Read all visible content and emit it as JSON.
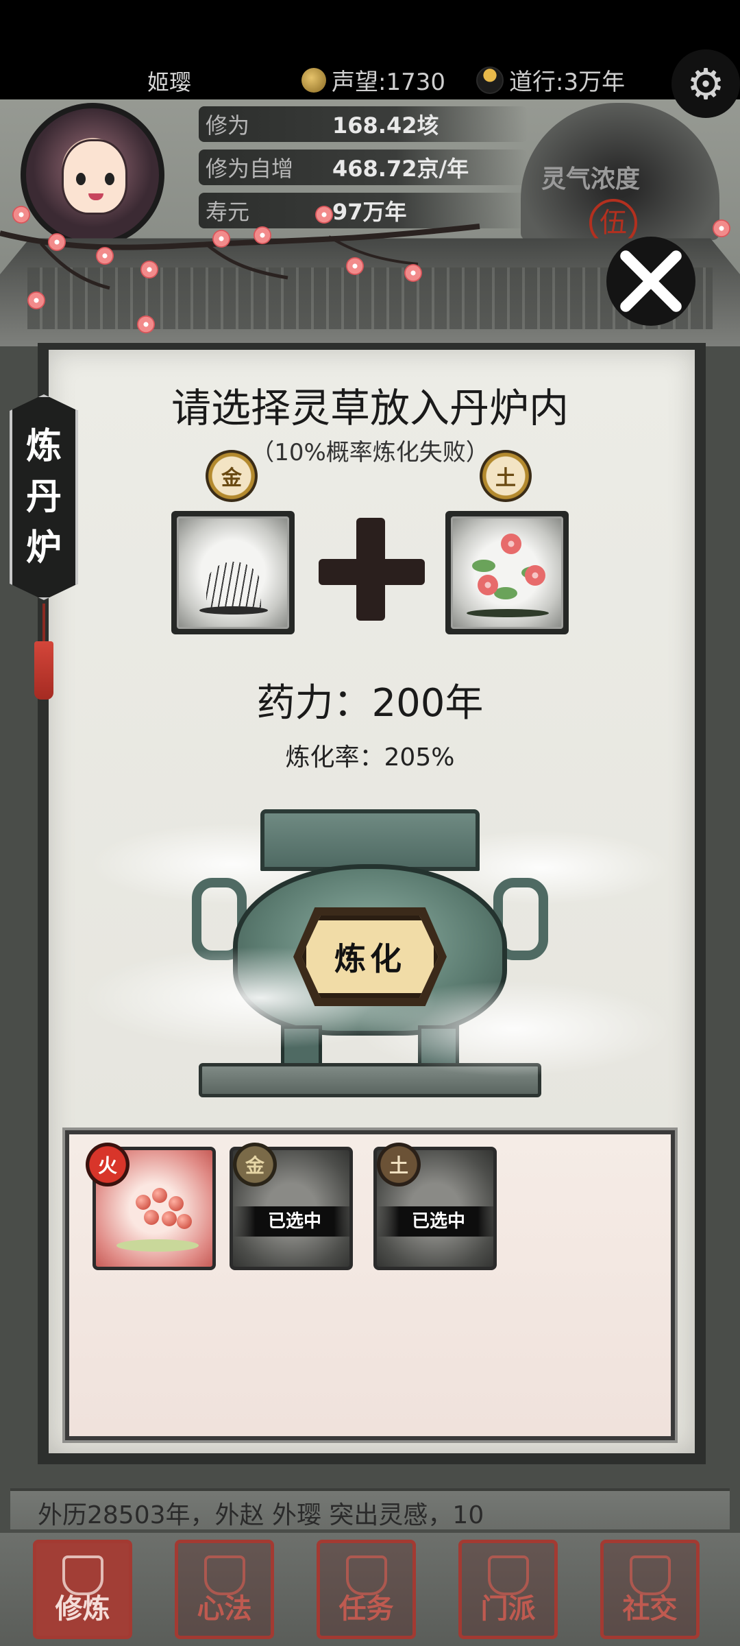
{
  "header": {
    "player_name": "姬璎",
    "reputation": "声望:1730",
    "cultivation_time": "道行:3万年"
  },
  "stats": [
    {
      "label": "修为",
      "value": "168.42垓"
    },
    {
      "label": "修为自增",
      "value": "468.72京/年"
    },
    {
      "label": "寿元",
      "value": "97万年"
    }
  ],
  "aura": {
    "label": "灵气浓度",
    "grade": "伍"
  },
  "side_tab": {
    "chars": [
      "炼",
      "丹",
      "炉"
    ]
  },
  "alchemy": {
    "title": "请选择灵草放入丹炉内",
    "subtitle": "（10%概率炼化失败）",
    "slot_left_element": "金",
    "slot_right_element": "土",
    "potency": "药力：200年",
    "refine_rate": "炼化率：205%",
    "refine_button": "炼化"
  },
  "inventory": [
    {
      "element": "火",
      "selected": false,
      "selected_label": ""
    },
    {
      "element": "金",
      "selected": true,
      "selected_label": "已选中"
    },
    {
      "element": "土",
      "selected": true,
      "selected_label": "已选中"
    }
  ],
  "ticker_text": "外历28503年，外赵 外璎 突出灵感，10",
  "nav": [
    {
      "label": "修炼",
      "active": true
    },
    {
      "label": "心法",
      "active": false
    },
    {
      "label": "任务",
      "active": false
    },
    {
      "label": "门派",
      "active": false
    },
    {
      "label": "社交",
      "active": false
    }
  ],
  "colors": {
    "panel_bg": "#ecece6",
    "frame": "#2d2f2d",
    "nav_accent": "#a33a32",
    "fire_tag": "#d8352a"
  }
}
